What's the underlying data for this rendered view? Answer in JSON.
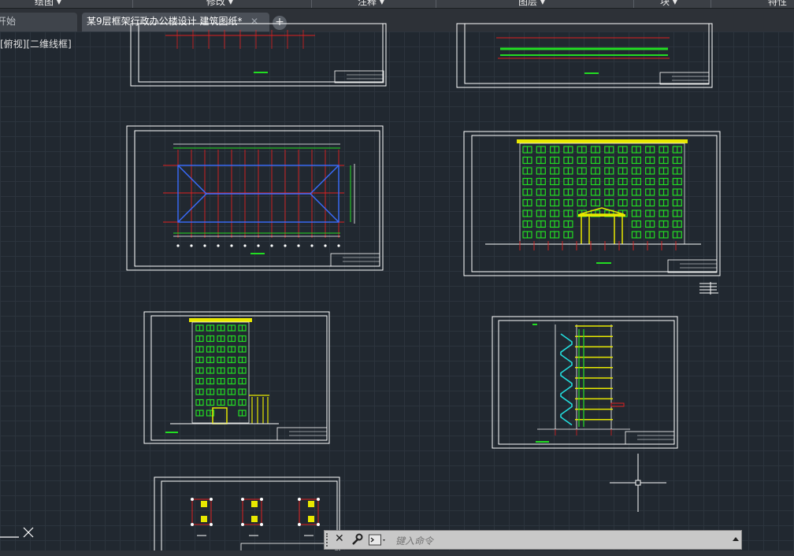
{
  "ribbon": {
    "panels": [
      "绘图",
      "修改",
      "注释",
      "图层",
      "块",
      "特性"
    ]
  },
  "tabs": {
    "start_label": "开始",
    "drawing_label": "某9层框架行政办公楼设计 建筑图纸*",
    "close_symbol": "✕",
    "add_symbol": "+"
  },
  "viewport": {
    "label": "[俯视][二维线框]"
  },
  "command_line": {
    "placeholder": "键入命令",
    "close_symbol": "✕"
  },
  "colors": {
    "canvas_bg": "#212830",
    "sheet_frame": "#ffffff",
    "axis_lines": "#e02020",
    "windows": "#22dd22",
    "roof_lines": "#3a6cff",
    "highlights": "#e8e800",
    "stair": "#22dddd"
  },
  "icons": {
    "crosshair": "crosshair-cursor-icon",
    "ucs": "ucs-icon",
    "wrench": "wrench-icon",
    "prompt": "command-prompt-icon"
  }
}
